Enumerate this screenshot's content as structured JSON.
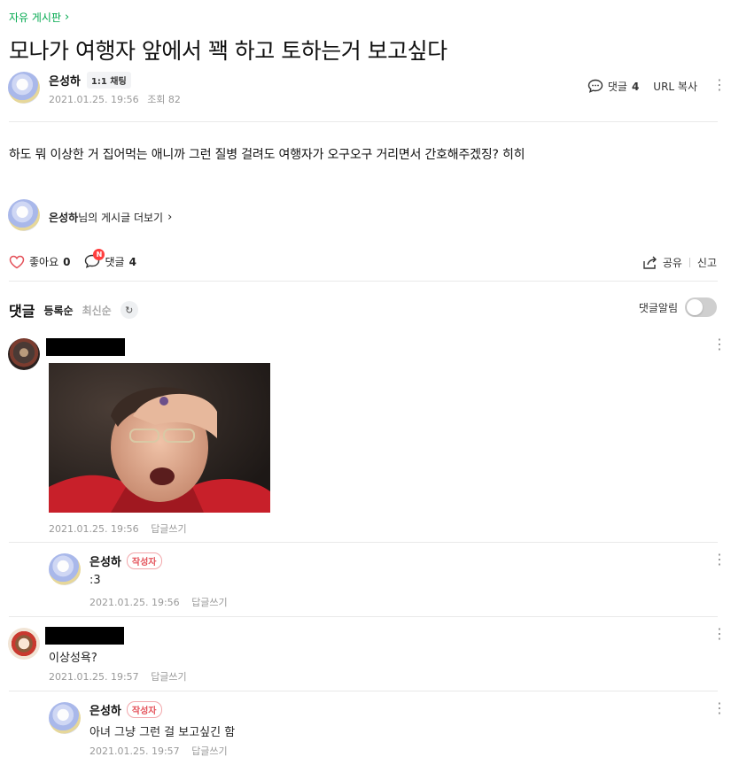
{
  "breadcrumb": {
    "board": "자유 게시판"
  },
  "post": {
    "title": "모나가 여행자 앞에서 꽥 하고 토하는거 보고싶다",
    "author": "은성하",
    "chat_badge": "1:1 채팅",
    "date": "2021.01.25. 19:56",
    "views_label": "조회 82",
    "comment_label": "댓글",
    "comment_count": "4",
    "url_copy": "URL 복사",
    "body": "하도 뭐 이상한 거 집어먹는 애니까 그런 질병 걸려도 여행자가 오구오구 거리면서 간호해주겠징? 히히",
    "more_author": "은성하",
    "more_suffix": "님의 게시글 더보기"
  },
  "actions": {
    "like_label": "좋아요",
    "like_count": "0",
    "comment_label": "댓글",
    "comment_count": "4",
    "new_badge": "N",
    "share": "공유",
    "report": "신고"
  },
  "comments_header": {
    "title": "댓글",
    "sort_registered": "등록순",
    "sort_latest": "최신순",
    "notify_label": "댓글알림",
    "notify_on": false
  },
  "comments": [
    {
      "author": "",
      "text": "",
      "date": "2021.01.25. 19:56",
      "reply": "답글쓰기",
      "has_image": true
    },
    {
      "author": "은성하",
      "badge": "작성자",
      "text": ":3",
      "date": "2021.01.25. 19:56",
      "reply": "답글쓰기"
    },
    {
      "author": "",
      "text": "이상성욕?",
      "date": "2021.01.25. 19:57",
      "reply": "답글쓰기"
    },
    {
      "author": "은성하",
      "badge": "작성자",
      "text": "아녀 그냥 그런 걸 보고싶긴 함",
      "date": "2021.01.25. 19:57",
      "reply": "답글쓰기"
    }
  ],
  "colors": {
    "accent_green": "#03a94f",
    "writer_red": "#e4525a",
    "badge_red": "#ff3f3f"
  }
}
